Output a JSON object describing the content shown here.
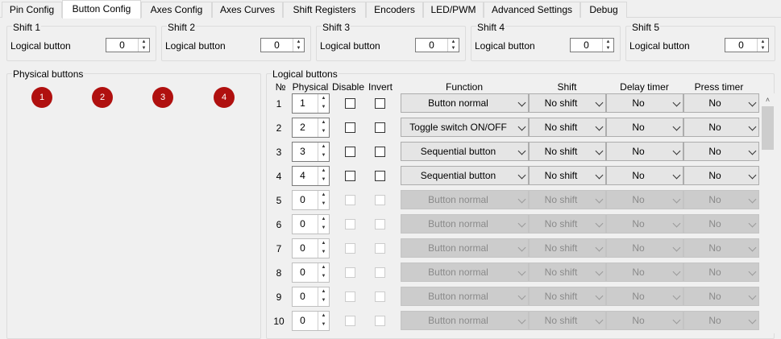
{
  "tabs": [
    "Pin Config",
    "Button Config",
    "Axes Config",
    "Axes Curves",
    "Shift Registers",
    "Encoders",
    "LED/PWM",
    "Advanced Settings",
    "Debug"
  ],
  "active_tab": "Button Config",
  "shifts": [
    {
      "title": "Shift 1",
      "label": "Logical button",
      "value": "0"
    },
    {
      "title": "Shift 2",
      "label": "Logical button",
      "value": "0"
    },
    {
      "title": "Shift 3",
      "label": "Logical button",
      "value": "0"
    },
    {
      "title": "Shift 4",
      "label": "Logical button",
      "value": "0"
    },
    {
      "title": "Shift 5",
      "label": "Logical button",
      "value": "0"
    }
  ],
  "physical": {
    "title": "Physical buttons",
    "buttons": [
      "1",
      "2",
      "3",
      "4"
    ]
  },
  "logical": {
    "title": "Logical buttons",
    "headers": {
      "num": "№",
      "physical": "Physical",
      "disable": "Disable",
      "invert": "Invert",
      "function": "Function",
      "shift": "Shift",
      "delay": "Delay timer",
      "press": "Press timer"
    },
    "rows": [
      {
        "n": "1",
        "physical": "1",
        "function": "Button normal",
        "shift": "No shift",
        "delay": "No",
        "press": "No",
        "enabled": true
      },
      {
        "n": "2",
        "physical": "2",
        "function": "Toggle switch ON/OFF",
        "shift": "No shift",
        "delay": "No",
        "press": "No",
        "enabled": true
      },
      {
        "n": "3",
        "physical": "3",
        "function": "Sequential button",
        "shift": "No shift",
        "delay": "No",
        "press": "No",
        "enabled": true
      },
      {
        "n": "4",
        "physical": "4",
        "function": "Sequential button",
        "shift": "No shift",
        "delay": "No",
        "press": "No",
        "enabled": true
      },
      {
        "n": "5",
        "physical": "0",
        "function": "Button normal",
        "shift": "No shift",
        "delay": "No",
        "press": "No",
        "enabled": false
      },
      {
        "n": "6",
        "physical": "0",
        "function": "Button normal",
        "shift": "No shift",
        "delay": "No",
        "press": "No",
        "enabled": false
      },
      {
        "n": "7",
        "physical": "0",
        "function": "Button normal",
        "shift": "No shift",
        "delay": "No",
        "press": "No",
        "enabled": false
      },
      {
        "n": "8",
        "physical": "0",
        "function": "Button normal",
        "shift": "No shift",
        "delay": "No",
        "press": "No",
        "enabled": false
      },
      {
        "n": "9",
        "physical": "0",
        "function": "Button normal",
        "shift": "No shift",
        "delay": "No",
        "press": "No",
        "enabled": false
      },
      {
        "n": "10",
        "physical": "0",
        "function": "Button normal",
        "shift": "No shift",
        "delay": "No",
        "press": "No",
        "enabled": false
      }
    ]
  },
  "icons": {
    "spin_up": "▲",
    "spin_down": "▼",
    "scroll_up": "˄"
  },
  "colors": {
    "physical_button": "#b0100f"
  }
}
